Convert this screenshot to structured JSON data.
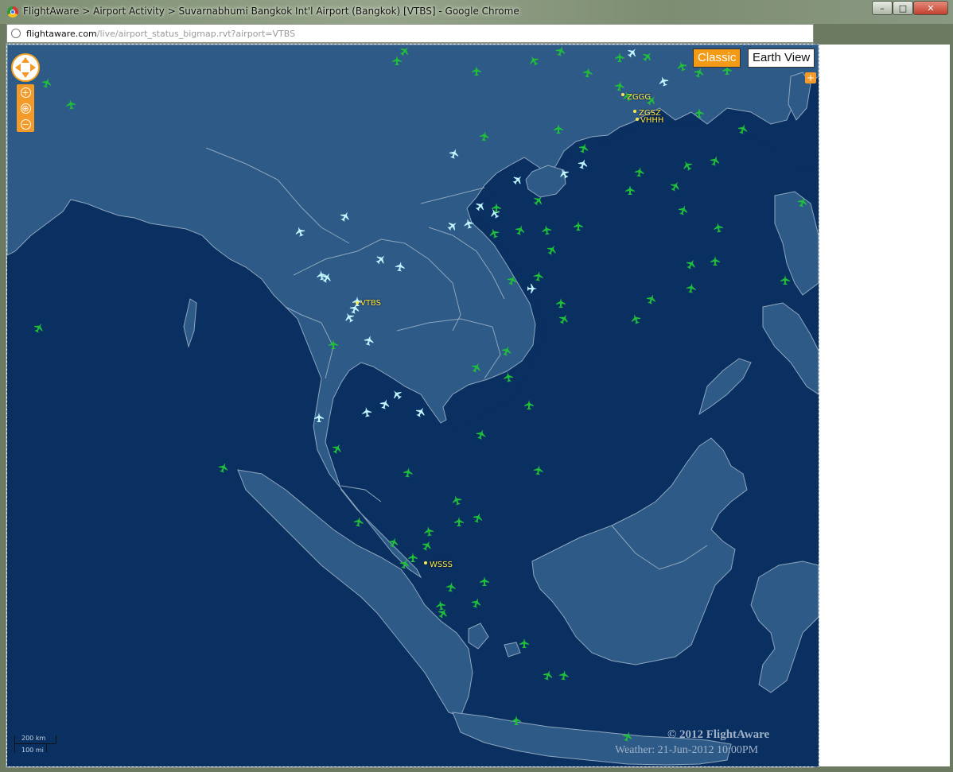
{
  "window": {
    "title": "FlightAware > Airport Activity > Suvarnabhumi Bangkok Int'l Airport (Bangkok) [VTBS] - Google Chrome",
    "min_label": "–",
    "max_label": "□",
    "close_label": "✕"
  },
  "address": {
    "host": "flightaware.com",
    "path": "/live/airport_status_bigmap.rvt?airport=VTBS"
  },
  "map": {
    "view_classic": "Classic",
    "view_earth": "Earth View",
    "active_view": "Classic",
    "zoom_in": "+",
    "zoom_out": "−",
    "expand_label": "+",
    "copyright": "© 2012 FlightAware",
    "weather": "Weather: 21-Jun-2012 10:00PM",
    "scale_top": "200 km",
    "scale_bottom": "100 mi",
    "airports": [
      {
        "code": "VTBS"
      },
      {
        "code": "ZGGG"
      },
      {
        "code": "ZGSZ"
      },
      {
        "code": "VHHH"
      },
      {
        "code": "WSSS"
      }
    ],
    "colors": {
      "ocean": "#0a2f61",
      "land": "#2d5a87",
      "border": "#8ea6bd",
      "highlight_plane": "#bff6ff",
      "other_plane": "#1fbf3a",
      "accent": "#f39a17"
    }
  }
}
